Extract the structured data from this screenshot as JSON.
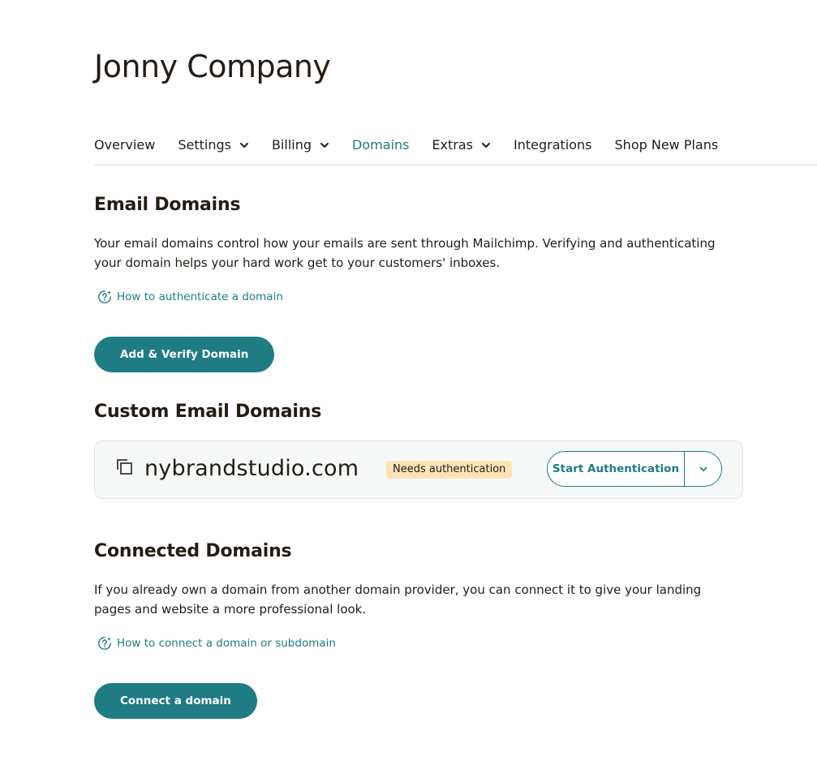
{
  "header": {
    "company_name": "Jonny Company"
  },
  "nav": {
    "items": [
      {
        "label": "Overview",
        "has_dropdown": false,
        "active": false
      },
      {
        "label": "Settings",
        "has_dropdown": true,
        "active": false
      },
      {
        "label": "Billing",
        "has_dropdown": true,
        "active": false
      },
      {
        "label": "Domains",
        "has_dropdown": false,
        "active": true
      },
      {
        "label": "Extras",
        "has_dropdown": true,
        "active": false
      },
      {
        "label": "Integrations",
        "has_dropdown": false,
        "active": false
      },
      {
        "label": "Shop New Plans",
        "has_dropdown": false,
        "active": false
      }
    ]
  },
  "email_domains": {
    "title": "Email Domains",
    "description": "Your email domains control how your emails are sent through Mailchimp. Verifying and authenticating your domain helps your hard work get to your customers' inboxes.",
    "help_link": "How to authenticate a domain",
    "button_label": "Add & Verify Domain"
  },
  "custom_email_domains": {
    "title": "Custom Email Domains",
    "domain": {
      "name": "nybrandstudio.com",
      "status": "Needs authentication",
      "action_label": "Start Authentication"
    }
  },
  "connected_domains": {
    "title": "Connected Domains",
    "description": "If you already own a domain from another domain provider, you can connect it to give your landing pages and website a more professional look.",
    "help_link": "How to connect a domain or subdomain",
    "button_label": "Connect a domain"
  },
  "colors": {
    "accent": "#1f7b84",
    "badge_bg": "#fde3b6",
    "text": "#241c15"
  },
  "icons": [
    "chevron-down-icon",
    "help-sparkle-icon",
    "copy-icon"
  ]
}
